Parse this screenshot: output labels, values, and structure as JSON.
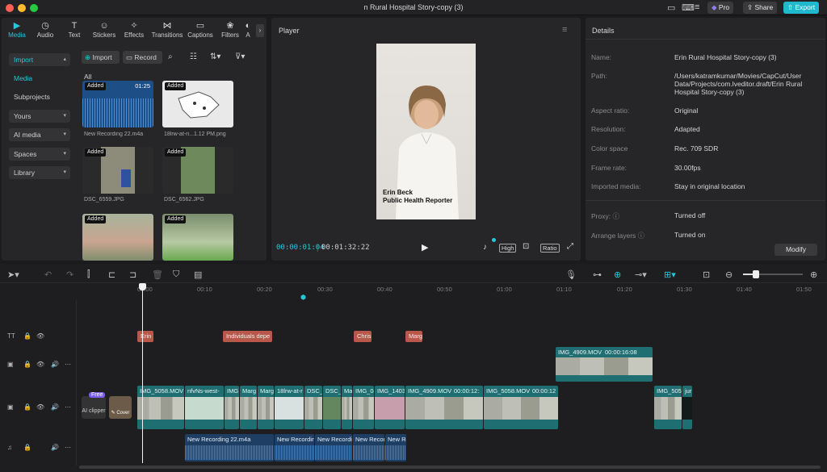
{
  "window": {
    "title": "n Rural Hospital Story-copy (3)",
    "pro_label": "Pro",
    "share_label": "Share",
    "export_label": "Export"
  },
  "toolbar": {
    "tabs": [
      {
        "label": "Media",
        "icon": "media-icon"
      },
      {
        "label": "Audio",
        "icon": "audio-icon"
      },
      {
        "label": "Text",
        "icon": "text-icon"
      },
      {
        "label": "Stickers",
        "icon": "sticker-icon"
      },
      {
        "label": "Effects",
        "icon": "effects-icon"
      },
      {
        "label": "Transitions",
        "icon": "transitions-icon"
      },
      {
        "label": "Captions",
        "icon": "captions-icon"
      },
      {
        "label": "Filters",
        "icon": "filters-icon"
      },
      {
        "label": "A",
        "icon": "adjust-icon"
      }
    ]
  },
  "sidebar": {
    "items": [
      {
        "label": "Import"
      },
      {
        "label": "Media"
      },
      {
        "label": "Subprojects"
      },
      {
        "label": "Yours"
      },
      {
        "label": "AI media"
      },
      {
        "label": "Spaces"
      },
      {
        "label": "Library"
      }
    ]
  },
  "media": {
    "import_label": "Import",
    "record_label": "Record",
    "filter_all": "All",
    "added_label": "Added",
    "items": [
      {
        "name": "New Recording 22.m4a",
        "duration": "01:25"
      },
      {
        "name": "18lrw-at-ri...1.12 PM.png",
        "duration": ""
      },
      {
        "name": "DSC_6559.JPG",
        "duration": ""
      },
      {
        "name": "DSC_6562.JPG",
        "duration": ""
      },
      {
        "name": "",
        "duration": ""
      },
      {
        "name": "",
        "duration": ""
      }
    ]
  },
  "player": {
    "title": "Player",
    "current_time": "00:00:01:04",
    "total_time": "00:01:32:22",
    "caption_line1": "Erin Beck",
    "caption_line2": "Public Health Reporter",
    "quality_label": "High",
    "ratio_label": "Ratio"
  },
  "details": {
    "title": "Details",
    "rows": [
      {
        "label": "Name:",
        "value": "Erin Rural Hospital Story-copy (3)"
      },
      {
        "label": "Path:",
        "value": "/Users/katramkumar/Movies/CapCut/User Data/Projects/com.lveditor.draft/Erin Rural Hospital Story-copy (3)"
      },
      {
        "label": "Aspect ratio:",
        "value": "Original"
      },
      {
        "label": "Resolution:",
        "value": "Adapted"
      },
      {
        "label": "Color space",
        "value": "Rec. 709 SDR"
      },
      {
        "label": "Frame rate:",
        "value": "30.00fps"
      },
      {
        "label": "Imported media:",
        "value": "Stay in original location"
      },
      {
        "label": "Proxy:",
        "value": "Turned off"
      },
      {
        "label": "Arrange layers",
        "value": "Turned on"
      }
    ],
    "modify_label": "Modify"
  },
  "timeline": {
    "ruler": [
      "00:00",
      "00:10",
      "00:20",
      "00:30",
      "00:40",
      "00:50",
      "01:00",
      "01:10",
      "01:20",
      "01:30",
      "01:40",
      "01:50"
    ],
    "text_clips": [
      "Erin B",
      "Individuals depe",
      "Chris",
      "Marg"
    ],
    "overlay_clip": {
      "name": "IMG_4909.MOV",
      "duration": "00:00:16:08"
    },
    "free_badge": "Free",
    "ai_clipper_label": "AI clipper",
    "cover_label": "Cover",
    "main_clips": [
      "IMG_5058.MOV",
      "nfvNs-west-",
      "IMG",
      "Marg",
      "Marg",
      "18lrw-at-r",
      "DSC_",
      "DSC_",
      "Ma",
      "IMG_04",
      "IMG_1403",
      "IMG_4909.MOV",
      "00:00:12:",
      "IMG_5058.MOV",
      "00:00:12",
      "IMG_505",
      "jur"
    ],
    "audio_clips": [
      "New Recording 22.m4a",
      "New Recordin",
      "New Recordi",
      "New Recor",
      "New Re"
    ]
  },
  "colors": {
    "accent": "#27c6d8",
    "text_clip": "#b9584a",
    "video_clip": "#1f6f72",
    "audio_clip": "#1e3f63"
  }
}
